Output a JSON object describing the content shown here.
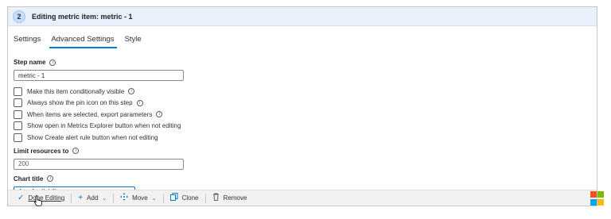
{
  "header": {
    "step_number": "2",
    "title": "Editing metric item: metric - 1"
  },
  "tabs": [
    {
      "label": "Settings"
    },
    {
      "label": "Advanced Settings",
      "active": true
    },
    {
      "label": "Style"
    }
  ],
  "fields": {
    "step_name_label": "Step name",
    "step_name_value": "metric - 1",
    "limit_label": "Limit resources to",
    "limit_value": "200",
    "chart_title_label": "Chart title",
    "chart_title_value": "App Availability"
  },
  "checkboxes": [
    {
      "label": "Make this item conditionally visible",
      "info": true
    },
    {
      "label": "Always show the pin icon on this step",
      "info": true
    },
    {
      "label": "When items are selected, export parameters",
      "info": true
    },
    {
      "label": "Show open in Metrics Explorer button when not editing",
      "info": false
    },
    {
      "label": "Show Create alert rule button when not editing",
      "info": false
    }
  ],
  "footer": {
    "done_label": "Done Editing",
    "add_label": "Add",
    "move_label": "Move",
    "clone_label": "Clone",
    "remove_label": "Remove"
  },
  "icons": {
    "info": "info-icon",
    "check": "checkmark-icon",
    "add": "plus-icon",
    "move": "move-icon",
    "clone": "clone-icon",
    "remove": "trash-icon"
  },
  "colors": {
    "accent": "#0078d4",
    "header_bg": "#e8f1fb"
  }
}
